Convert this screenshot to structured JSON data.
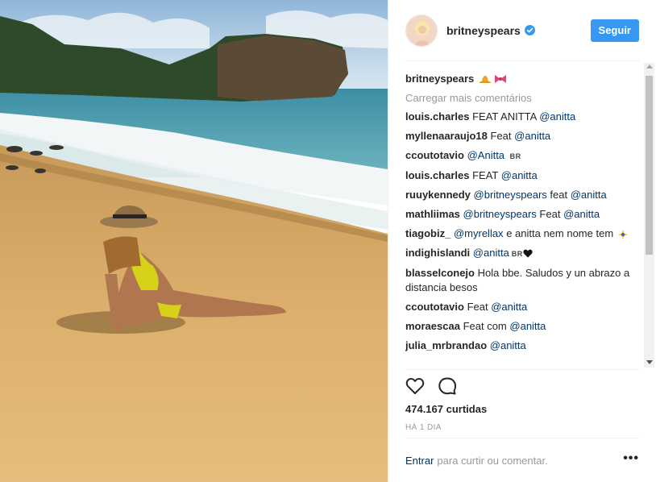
{
  "post": {
    "username": "britneyspears",
    "follow_label": "Seguir",
    "caption_user": "britneyspears",
    "load_more": "Carregar mais comentários",
    "likes": "474.167 curtidas",
    "time": "HÁ 1 DIA",
    "login_link": "Entrar",
    "login_rest": "para curtir ou comentar.",
    "more": "•••"
  },
  "comments": [
    {
      "user": "louis.charles",
      "text": "FEAT ANITTA",
      "mention": "@anitta"
    },
    {
      "user": "myllenaaraujo18",
      "text": "Feat",
      "mention": "@anitta"
    },
    {
      "user": "ccoutotavio",
      "text": "",
      "mention": "@Anitta",
      "suffix": "BR"
    },
    {
      "user": "louis.charles",
      "text": "FEAT",
      "mention": "@anitta"
    },
    {
      "user": "ruuykennedy",
      "text": "",
      "mention": "@britneyspears",
      "text2": "feat",
      "mention2": "@anitta"
    },
    {
      "user": "mathliimas",
      "text": "",
      "mention": "@britneyspears",
      "text2": "Feat",
      "mention2": "@anitta"
    },
    {
      "user": "tiagobiz_",
      "text": "",
      "mention": "@myrellax",
      "text2": "e anitta nem nome tem"
    },
    {
      "user": "indighislandi",
      "text": "",
      "mention": "@anitta",
      "suffix": "BR"
    },
    {
      "user": "blasselconejo",
      "text": "Hola bbe. Saludos y un abrazo a distancia besos"
    },
    {
      "user": "ccoutotavio",
      "text": "Feat",
      "mention": "@anitta"
    },
    {
      "user": "moraescaa",
      "text": "Feat com",
      "mention": "@anitta"
    },
    {
      "user": "julia_mrbrandao",
      "text": "",
      "mention": "@anitta"
    }
  ],
  "colors": {
    "accent": "#3897f0",
    "link": "#003569",
    "muted": "#999999",
    "text": "#262626"
  },
  "icons": [
    "verified-badge-icon",
    "heart-icon",
    "comment-icon",
    "more-options-icon"
  ]
}
